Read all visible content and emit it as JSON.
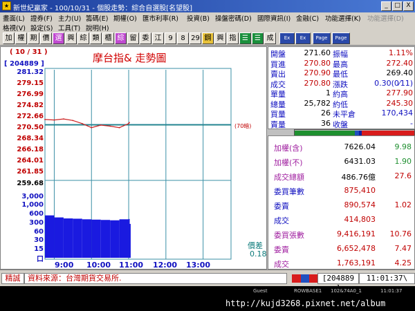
{
  "window": {
    "title": "新世紀贏家 - 100/10/31 - 個股走勢：綜合自選股[名望股]",
    "app_icon": "app-logo-icon",
    "buttons": [
      "_",
      "□",
      "X"
    ]
  },
  "menu": {
    "row1": [
      "畫面(L)",
      "證券(F)",
      "主力(U)",
      "籌碼(E)",
      "期權(O)",
      "匯市利率(R)",
      "投資(B)",
      "操盤密碼(D)",
      "國際資訊(I)",
      "金融(C)",
      "功能選擇(K)",
      "功能選擇(D)"
    ],
    "row2": [
      "格視(V)",
      "設定(S)",
      "工具(T)",
      "說明(H)"
    ]
  },
  "toolbar": {
    "buttons": [
      "加",
      "權",
      "期",
      "價",
      "選",
      "興",
      "綜",
      "類",
      "櫃",
      "綜",
      "留",
      "委",
      "江",
      "9",
      "8",
      "29",
      "鋼",
      "興",
      "指",
      "☰",
      "☰",
      "成",
      "Ex",
      "Ex",
      "Page",
      "Page"
    ]
  },
  "chart": {
    "date_label": "( 10 / 31 )",
    "title": "摩台指& 走勢圖",
    "code_label": "[ 204889 ]",
    "price_ticks": [
      "281.32",
      "279.15",
      "276.99",
      "274.82",
      "272.66",
      "270.50",
      "268.34",
      "266.18",
      "264.01",
      "261.85",
      "259.68"
    ],
    "volume_ticks": [
      "3,000",
      "1,000",
      "600",
      "300",
      "60",
      "30",
      "15",
      "口"
    ],
    "ref_label": "(70暗)",
    "bias_label": "價差",
    "bias_value": "0.18",
    "x_ticks": [
      "9:00",
      "10:00",
      "11:00",
      "12:00",
      "13:00"
    ]
  },
  "chart_data": {
    "type": "line",
    "title": "摩台指& 走勢圖",
    "xlabel": "",
    "ylabel": "",
    "x_ticks": [
      "9:00",
      "10:00",
      "11:00",
      "12:00",
      "13:00"
    ],
    "ylim": [
      259.68,
      281.32
    ],
    "reference_price": 270.5,
    "series": [
      {
        "x": [
          "08:45",
          "09:00",
          "09:15",
          "09:30",
          "09:45",
          "10:00",
          "10:15",
          "10:30",
          "10:45",
          "11:00",
          "11:01"
        ],
        "values": [
          271.6,
          271.5,
          271.7,
          271.4,
          270.8,
          270.0,
          270.5,
          270.3,
          270.0,
          270.8,
          271.0
        ]
      },
      {
        "x": [
          "08:45",
          "09:00",
          "09:15",
          "09:30",
          "09:45",
          "10:00",
          "10:15",
          "10:30",
          "10:45",
          "11:00",
          "11:01"
        ],
        "values": [
          400,
          300,
          260,
          250,
          230,
          220,
          210,
          200,
          230,
          240,
          120
        ]
      }
    ]
  },
  "quote": {
    "rows": [
      {
        "l1": "開盤",
        "v1": "271.60",
        "l2": "振幅",
        "v2": "1.11%"
      },
      {
        "l1": "買進",
        "v1": "270.80",
        "l2": "最高",
        "v2": "272.40"
      },
      {
        "l1": "賣出",
        "v1": "270.90",
        "l2": "最低",
        "v2": "269.40"
      },
      {
        "l1": "成交",
        "v1": "270.80",
        "l2": "漲跌",
        "v2": "0.30(0⁄11)"
      },
      {
        "l1": "單量",
        "v1": "1",
        "l2": "約高",
        "v2": "277.90"
      },
      {
        "l1": "總量",
        "v1": "25,782",
        "l2": "約低",
        "v2": "245.30"
      },
      {
        "l1": "買量",
        "v1": "26",
        "l2": "未平倉",
        "v2": "170,434"
      },
      {
        "l1": "賣量",
        "v1": "36",
        "l2": "收盤",
        "v2": "-"
      }
    ]
  },
  "stats": {
    "rows": [
      {
        "label": "加權(含)",
        "value": "7626.04",
        "pct": "9.98"
      },
      {
        "label": "加權(不)",
        "value": "6431.03",
        "pct": "1.90"
      },
      {
        "label": "成交總額",
        "value": "486.76億",
        "pct": "27.6"
      },
      {
        "label": "委買筆數",
        "value": "875,410",
        "pct": ""
      },
      {
        "label": "委賣",
        "value": "890,574",
        "pct": "1.02"
      },
      {
        "label": "成交",
        "value": "414,803",
        "pct": ""
      },
      {
        "label": "委買張數",
        "value": "9,416,191",
        "pct": "10.76"
      },
      {
        "label": "委賣",
        "value": "6,652,478",
        "pct": "7.47"
      },
      {
        "label": "成交",
        "value": "1,763,191",
        "pct": "4.25"
      }
    ]
  },
  "status": {
    "label": "精誠",
    "message": "資料來源：台灣期貨交易所.",
    "code": "[204889 ]",
    "time": "11:01:37\\"
  },
  "taskbar": {
    "items": [
      "Guest",
      "ROWBASE1",
      "102&74A0_1",
      "11:01:37"
    ],
    "url": "http://kujd3268.pixnet.net/album"
  },
  "colors": {
    "price_line": "#cc2020",
    "volume_bar": "#1a1ae0",
    "grid": "#3a8fa6",
    "ref_line": "#0b7a7a"
  }
}
